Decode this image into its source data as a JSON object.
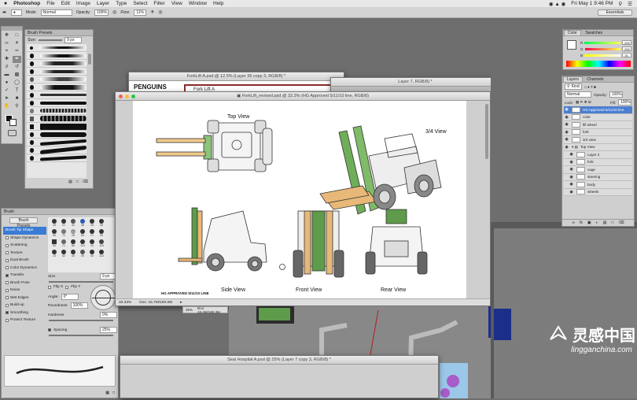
{
  "menubar": {
    "apple": "",
    "app": "Photoshop",
    "items": [
      "File",
      "Edit",
      "Image",
      "Layer",
      "Type",
      "Select",
      "Filter",
      "View",
      "Window",
      "Help"
    ],
    "datetime": "Fri May 1  9:46 PM"
  },
  "options": {
    "mode_label": "Mode:",
    "mode_value": "Normal",
    "opacity_label": "Opacity:",
    "opacity_value": "100%",
    "flow_label": "Flow:",
    "flow_value": "11%",
    "workspace": "Essentials"
  },
  "brush_presets": {
    "title": "Brush Presets",
    "size_label": "Size:",
    "size_value": "9 px"
  },
  "brush_panel": {
    "title": "Brush",
    "presets_button": "Brush Presets",
    "options": [
      "Brush Tip Shape",
      "Shape Dynamics",
      "Scattering",
      "Texture",
      "Dual Brush",
      "Color Dynamics",
      "Transfer",
      "Brush Pose",
      "Noise",
      "Wet Edges",
      "Build-up",
      "Smoothing",
      "Protect Texture"
    ],
    "tip_sizes": [
      "25",
      "21",
      "32",
      "36",
      "25",
      "25",
      "50",
      "71",
      "25",
      "50",
      "71",
      "25",
      "50",
      "71",
      "80",
      "113",
      "13",
      "119",
      "23",
      "62",
      "40",
      "40",
      "40",
      "113"
    ],
    "size_label": "Size",
    "size_value": "9 px",
    "flip_x": "Flip X",
    "flip_y": "Flip Y",
    "angle_label": "Angle:",
    "angle_value": "0°",
    "roundness_label": "Roundness:",
    "roundness_value": "100%",
    "hardness_label": "Hardness",
    "hardness_value": "0%",
    "spacing_label": "Spacing",
    "spacing_value": "25%"
  },
  "doc_back": {
    "title": "ForkLift A.psd @ 12.5% (Layer 36 copy 3, RGB/8) *",
    "banner": "PENGUINS",
    "header": "Fork Lift A"
  },
  "doc_back2": {
    "title": "Layer 7, RGB/8) *"
  },
  "doc_main": {
    "title": "ForkLift_revised.psd @ 33.3% (HG Approved 5/11/10 line, RGB/8)",
    "top_view": "Top View",
    "three_quarter_view": "3/4 View",
    "side_view": "Side View",
    "front_view": "Front View",
    "rear_view": "Rear View",
    "approval": "HG APPROVED 5/11/10 LINE",
    "zoom": "33.33%",
    "doc_size": "Doc: 15.7M/180.0M"
  },
  "doc_sub": {
    "zoom": "25%",
    "doc_size": "Doc: 18.4M/180.3M"
  },
  "doc_bottom": {
    "title": "Seal Hospital A.psd @ 25% (Layer 7 copy 3, RGB/8) *"
  },
  "color_panel": {
    "tabs": [
      "Color",
      "Swatches"
    ],
    "values": [
      "R",
      "G",
      "B"
    ],
    "readouts": [
      "255",
      "255",
      "78"
    ]
  },
  "layers_panel": {
    "tabs": [
      "Layers",
      "Channels"
    ],
    "kind_label": "Kind",
    "blend": "Normal",
    "opacity_label": "Opacity:",
    "opacity_value": "100%",
    "lock_label": "Lock:",
    "fill_label": "Fill:",
    "fill_value": "100%",
    "layers": [
      "HG Approved 5/11/10 line",
      "color",
      "fill wheel",
      "fork",
      "3/4 view",
      "Top View",
      "Layer 2",
      "fork",
      "cage",
      "steering",
      "body",
      "wheels"
    ]
  },
  "watermark": {
    "line1": "灵感中国",
    "line2": "lingganchina.com"
  },
  "colors": {
    "accent": "#4a7fd1",
    "forklift_green": "#5e9b4a",
    "forklift_orange": "#e8b878",
    "watermark": "#ffffff"
  }
}
